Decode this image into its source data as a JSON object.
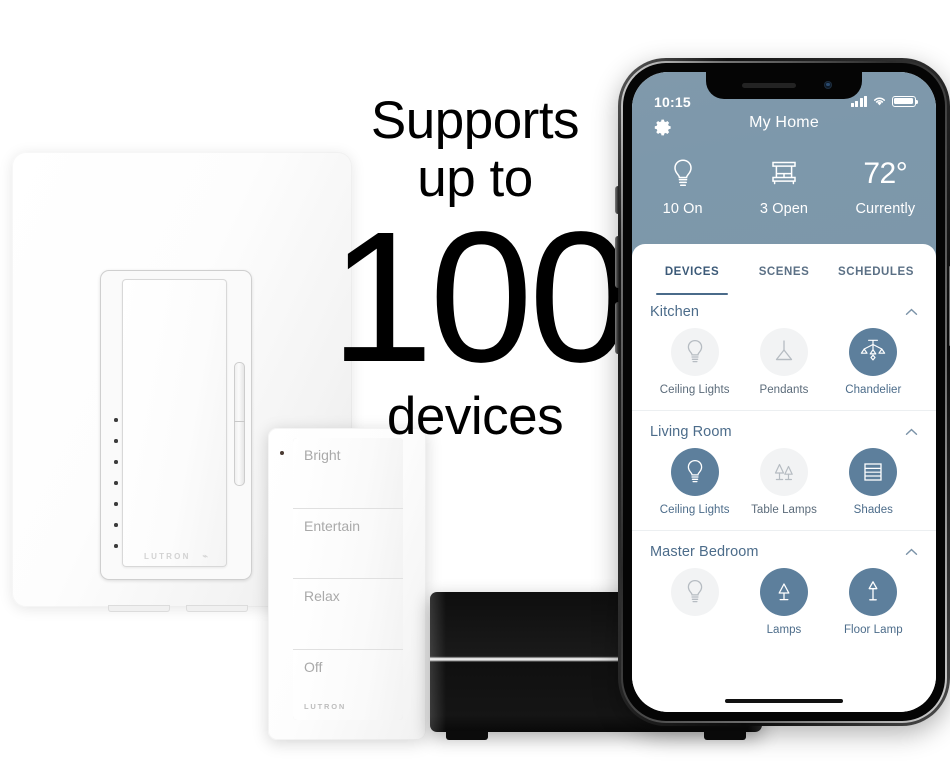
{
  "promo": {
    "line1": "Supports",
    "line2": "up to",
    "number": "100",
    "line3": "devices"
  },
  "dimmer": {
    "brand": "LUTRON",
    "brand_symbol": "⌁",
    "led_count": 7
  },
  "pico_remote": {
    "brand": "LUTRON",
    "buttons": [
      {
        "label": "Bright"
      },
      {
        "label": "Entertain"
      },
      {
        "label": "Relax"
      },
      {
        "label": "Off"
      }
    ]
  },
  "bridge": {
    "name": "smart-bridge-hub"
  },
  "phone": {
    "status_bar": {
      "time": "10:15",
      "cellular_icon": "signal-bars-icon",
      "wifi_icon": "wifi-icon",
      "battery_icon": "battery-full-icon"
    },
    "header": {
      "settings_icon": "gear-icon",
      "title": "My Home",
      "summary": [
        {
          "icon": "lightbulb-icon",
          "value": "10 On"
        },
        {
          "icon": "shade-icon",
          "value": "3 Open"
        },
        {
          "icon": "temperature",
          "value": "72°",
          "label": "Currently"
        }
      ]
    },
    "tabs": [
      {
        "label": "DEVICES",
        "active": true
      },
      {
        "label": "SCENES",
        "active": false
      },
      {
        "label": "SCHEDULES",
        "active": false
      }
    ],
    "rooms": [
      {
        "name": "Kitchen",
        "collapse_icon": "chevron-up-icon",
        "devices": [
          {
            "label": "Ceiling Lights",
            "icon": "lightbulb-icon",
            "on": false
          },
          {
            "label": "Pendants",
            "icon": "pendant-light-icon",
            "on": false
          },
          {
            "label": "Chandelier",
            "icon": "chandelier-icon",
            "on": true
          }
        ]
      },
      {
        "name": "Living Room",
        "collapse_icon": "chevron-up-icon",
        "devices": [
          {
            "label": "Ceiling Lights",
            "icon": "lightbulb-icon",
            "on": true
          },
          {
            "label": "Table Lamps",
            "icon": "table-lamp-icon",
            "on": false
          },
          {
            "label": "Shades",
            "icon": "shade-icon",
            "on": true
          }
        ]
      },
      {
        "name": "Master Bedroom",
        "collapse_icon": "chevron-up-icon",
        "devices": [
          {
            "label": "",
            "icon": "lightbulb-icon",
            "on": false
          },
          {
            "label": "Lamps",
            "icon": "table-lamp-icon",
            "on": true
          },
          {
            "label": "Floor Lamp",
            "icon": "floor-lamp-icon",
            "on": true
          }
        ]
      }
    ]
  },
  "colors": {
    "header_blue": "#7d97aa",
    "accent_blue": "#5d7f9c",
    "tab_active": "#3c5a78",
    "room_title": "#4c6c8a",
    "inactive_circle": "#f2f3f4",
    "page_bg": "#ffffff"
  }
}
